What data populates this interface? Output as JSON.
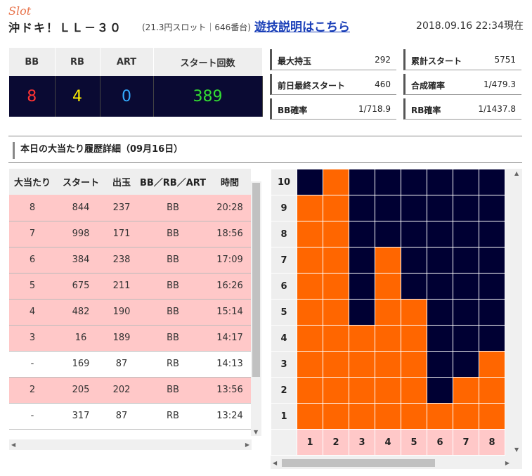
{
  "header": {
    "category": "Slot",
    "machine": "沖ドキ！ＬＬ－３０",
    "rate": "(21.3円スロット｜646番台)",
    "howto_link": "遊技説明はこちら",
    "datetime": "2018.09.16 22:34現在"
  },
  "counter": {
    "labels": [
      "BB",
      "RB",
      "ART",
      "スタート回数"
    ],
    "values": [
      "8",
      "4",
      "0",
      "389"
    ],
    "colors": [
      "#ff3333",
      "#ffee00",
      "#33aaff",
      "#33dd33"
    ]
  },
  "stats": [
    {
      "label": "最大持玉",
      "value": "292"
    },
    {
      "label": "累計スタート",
      "value": "5751"
    },
    {
      "label": "前日最終スタート",
      "value": "460"
    },
    {
      "label": "合成確率",
      "value": "1/479.3"
    },
    {
      "label": "BB確率",
      "value": "1/718.9"
    },
    {
      "label": "RB確率",
      "value": "1/1437.8"
    }
  ],
  "history": {
    "title": "本日の大当たり履歴詳細（09月16日）",
    "headers": [
      "大当たり",
      "スタート",
      "出玉",
      "BB／RB／ART",
      "時間"
    ],
    "rows": [
      [
        "8",
        "844",
        "237",
        "BB",
        "20:28"
      ],
      [
        "7",
        "998",
        "171",
        "BB",
        "18:56"
      ],
      [
        "6",
        "384",
        "238",
        "BB",
        "17:09"
      ],
      [
        "5",
        "675",
        "211",
        "BB",
        "16:26"
      ],
      [
        "4",
        "482",
        "190",
        "BB",
        "15:14"
      ],
      [
        "3",
        "16",
        "189",
        "BB",
        "14:17"
      ],
      [
        "-",
        "169",
        "87",
        "RB",
        "14:13"
      ],
      [
        "2",
        "205",
        "202",
        "BB",
        "13:56"
      ],
      [
        "-",
        "317",
        "87",
        "RB",
        "13:24"
      ]
    ]
  },
  "grid": {
    "y_labels": [
      "10",
      "9",
      "8",
      "7",
      "6",
      "5",
      "4",
      "3",
      "2",
      "1"
    ],
    "x_labels": [
      "1",
      "2",
      "3",
      "4",
      "5",
      "6",
      "7",
      "8"
    ],
    "colors": {
      "filled": "#ff6600",
      "empty": "#000033"
    },
    "cells": [
      "N O N N N N N N",
      "O O N N N N N N",
      "O O N N N N N N",
      "O O N O N N N N",
      "O O N O N N N N",
      "O O N O O N N N",
      "O O O O O N N N",
      "O O O O O N N O",
      "O O O O O N O O",
      "O O O O O O O O"
    ]
  }
}
